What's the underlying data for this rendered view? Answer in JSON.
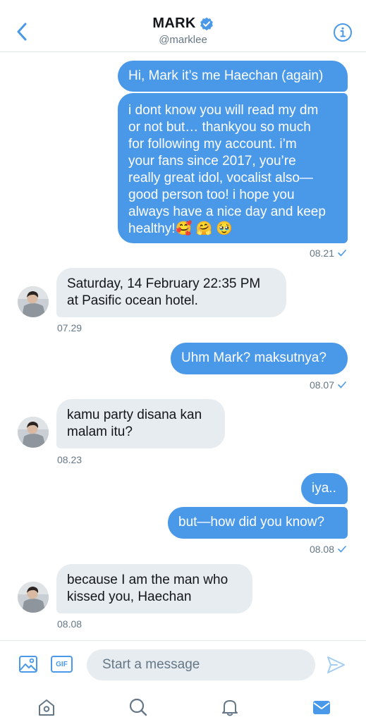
{
  "header": {
    "title": "MARK",
    "handle": "@marklee",
    "back_icon": "chevron-left-icon",
    "info_icon": "info-icon",
    "verified_icon": "verified-badge-icon"
  },
  "messages": [
    {
      "from": "me",
      "text": "Hi, Mark it’s me Haechan (again)"
    },
    {
      "from": "me",
      "text": "i dont know you will read my dm or not but… thankyou so much for following my account. i’m your fans since 2017, you’re really great idol, vocalist also— good person too! i hope you always have a nice day and keep healthy!🥰 🤗 🥹"
    },
    {
      "from": "me",
      "time": "08.21"
    },
    {
      "from": "mark",
      "text": "Saturday, 14 February 22:35 PM at Pasific ocean hotel.",
      "time": "07.29"
    },
    {
      "from": "me",
      "text": "Uhm Mark? maksutnya?",
      "time": "08.07"
    },
    {
      "from": "mark",
      "text": "kamu party disana kan malam itu?",
      "time": "08.23"
    },
    {
      "from": "me",
      "text": "iya.."
    },
    {
      "from": "me",
      "text": "but—how did you know?",
      "time": "08.08"
    },
    {
      "from": "mark",
      "text": "because I am the man who kissed you, Haechan",
      "time": "08.08"
    }
  ],
  "message_texts": {
    "m1": "Hi, Mark it’s me Haechan (again)",
    "m2_line1": "i dont know you will read my dm",
    "m2_line2": "or not but… thankyou so much",
    "m2_line3": "for following my account. i’m",
    "m2_line4": "your fans since 2017, you’re",
    "m2_line5": "really great idol, vocalist also—",
    "m2_line6": "good person too! i hope you",
    "m2_line7": "always have a nice day and keep",
    "m2_line8": "healthy!🥰 🤗 🥹",
    "t1": "08.21",
    "r1_line1": "Saturday, 14 February 22:35 PM",
    "r1_line2": "at Pasific ocean hotel.",
    "t2": "07.29",
    "m3": "Uhm Mark? maksutnya?",
    "t3": "08.07",
    "r2_line1": "kamu party disana kan",
    "r2_line2": "malam itu?",
    "t4": "08.23",
    "m4": "iya..",
    "m5": "but—how did you know?",
    "t5": "08.08",
    "r3_line1": "because I am the man who",
    "r3_line2": "kissed you, Haechan",
    "t6": "08.08"
  },
  "composer": {
    "placeholder": "Start a message",
    "gif_label": "GIF",
    "photo_icon": "image-icon",
    "send_icon": "send-icon"
  },
  "tabs": [
    {
      "name": "home",
      "icon": "home-icon",
      "active": false
    },
    {
      "name": "search",
      "icon": "search-icon",
      "active": false
    },
    {
      "name": "notifications",
      "icon": "bell-icon",
      "active": false
    },
    {
      "name": "messages",
      "icon": "mail-icon",
      "active": true
    }
  ],
  "colors": {
    "accent": "#4a99e9",
    "received_bubble": "#e6ecf0",
    "secondary_text": "#657786",
    "inactive_icon": "#657786"
  }
}
